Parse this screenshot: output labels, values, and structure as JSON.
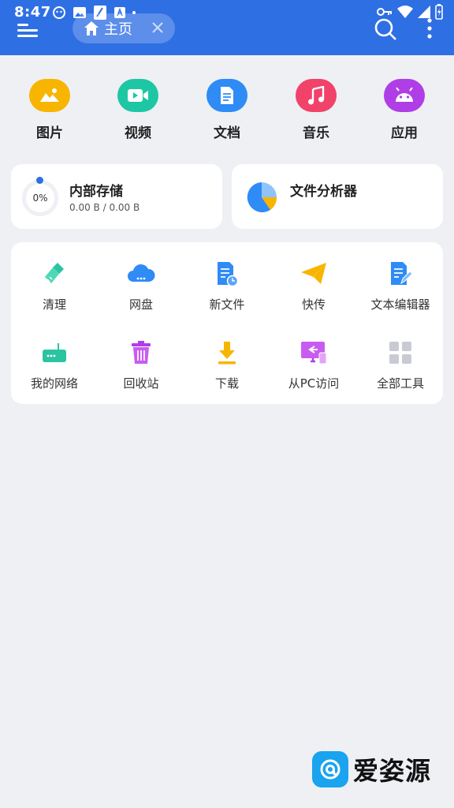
{
  "status_bar": {
    "time": "8:47"
  },
  "header": {
    "tab_label": "主页"
  },
  "categories": [
    {
      "label": "图片",
      "icon": "image-icon",
      "color": "#f7b500"
    },
    {
      "label": "视频",
      "icon": "video-icon",
      "color": "#1ec7a3"
    },
    {
      "label": "文档",
      "icon": "document-icon",
      "color": "#2f8bf5"
    },
    {
      "label": "音乐",
      "icon": "music-icon",
      "color": "#f1426a"
    },
    {
      "label": "应用",
      "icon": "android-icon",
      "color": "#b03ee6"
    }
  ],
  "storage": {
    "title": "内部存储",
    "percent": "0%",
    "usage": "0.00 B / 0.00 B"
  },
  "analyzer": {
    "title": "文件分析器"
  },
  "tools": [
    {
      "label": "清理",
      "icon": "broom-icon"
    },
    {
      "label": "网盘",
      "icon": "cloud-drive-icon"
    },
    {
      "label": "新文件",
      "icon": "new-file-icon"
    },
    {
      "label": "快传",
      "icon": "paper-plane-icon"
    },
    {
      "label": "文本编辑器",
      "icon": "text-editor-icon"
    },
    {
      "label": "我的网络",
      "icon": "router-icon"
    },
    {
      "label": "回收站",
      "icon": "trash-icon"
    },
    {
      "label": "下载",
      "icon": "download-icon"
    },
    {
      "label": "从PC访问",
      "icon": "pc-access-icon"
    },
    {
      "label": "全部工具",
      "icon": "all-tools-grid-icon"
    }
  ],
  "watermark": {
    "text": "爱姿源"
  }
}
